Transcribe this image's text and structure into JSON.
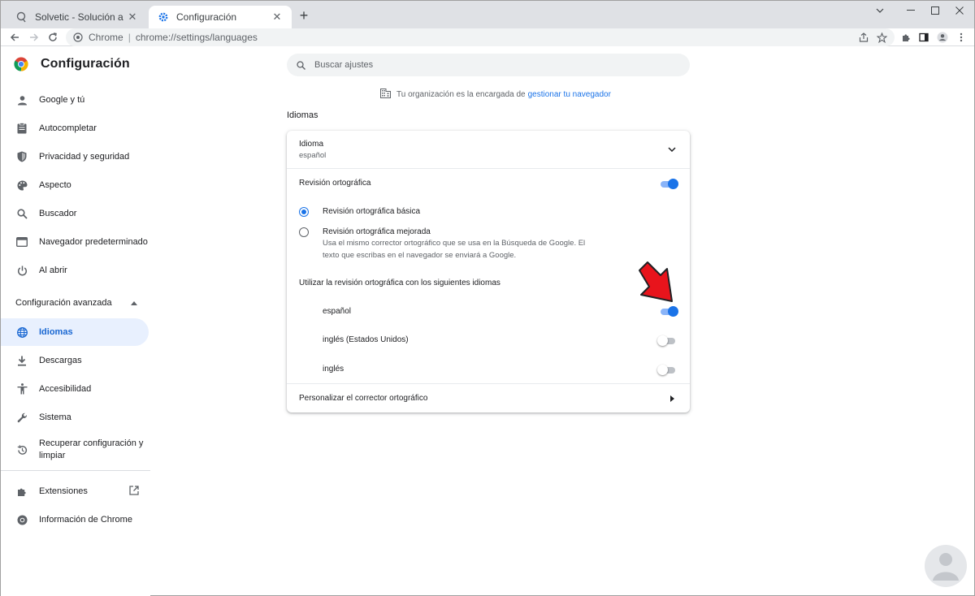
{
  "browser": {
    "tabs": [
      {
        "title": "Solvetic - Solución a los problemas",
        "active": false
      },
      {
        "title": "Configuración",
        "active": true
      }
    ],
    "omnibox": {
      "chip": "Chrome",
      "url": "chrome://settings/languages"
    }
  },
  "sidebar": {
    "title": "Configuración",
    "items": [
      {
        "label": "Google y tú"
      },
      {
        "label": "Autocompletar"
      },
      {
        "label": "Privacidad y seguridad"
      },
      {
        "label": "Aspecto"
      },
      {
        "label": "Buscador"
      },
      {
        "label": "Navegador predeterminado"
      },
      {
        "label": "Al abrir"
      }
    ],
    "advanced_label": "Configuración avanzada",
    "advanced_items": [
      {
        "label": "Idiomas",
        "active": true
      },
      {
        "label": "Descargas"
      },
      {
        "label": "Accesibilidad"
      },
      {
        "label": "Sistema"
      },
      {
        "label": "Recuperar configuración y limpiar"
      }
    ],
    "footer_items": [
      {
        "label": "Extensiones"
      },
      {
        "label": "Información de Chrome"
      }
    ]
  },
  "search": {
    "placeholder": "Buscar ajustes"
  },
  "managed": {
    "text": "Tu organización es la encargada de",
    "link": "gestionar tu navegador"
  },
  "section_title": "Idiomas",
  "card": {
    "language_label": "Idioma",
    "language_value": "español",
    "spellcheck_label": "Revisión ortográfica",
    "spellcheck_enabled": true,
    "basic_label": "Revisión ortográfica básica",
    "enhanced_label": "Revisión ortográfica mejorada",
    "enhanced_desc_1": "Usa el mismo corrector ortográfico que se usa en la Búsqueda de Google. El",
    "enhanced_desc_2": "texto que escribas en el navegador se enviará a Google.",
    "languages_header": "Utilizar la revisión ortográfica con los siguientes idiomas",
    "languages": [
      {
        "label": "español",
        "enabled": true
      },
      {
        "label": "inglés (Estados Unidos)",
        "enabled": false
      },
      {
        "label": "inglés",
        "enabled": false
      }
    ],
    "customize_label": "Personalizar el corrector ortográfico"
  },
  "colors": {
    "accent": "#1a73e8",
    "active_bg": "#e8f0fe",
    "arrow": "#e8141c"
  }
}
